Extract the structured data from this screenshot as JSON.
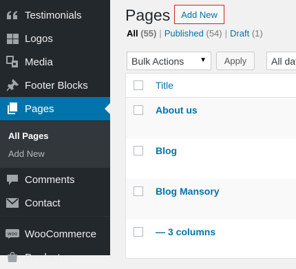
{
  "sidebar": {
    "items": [
      {
        "label": "Testimonials",
        "icon": "quote-icon"
      },
      {
        "label": "Logos",
        "icon": "grid-icon"
      },
      {
        "label": "Media",
        "icon": "media-icon"
      },
      {
        "label": "Footer Blocks",
        "icon": "pin-icon"
      },
      {
        "label": "Pages",
        "icon": "pages-icon"
      },
      {
        "label": "Comments",
        "icon": "comment-icon"
      },
      {
        "label": "Contact",
        "icon": "mail-icon"
      },
      {
        "label": "WooCommerce",
        "icon": "woo-icon"
      },
      {
        "label": "Products",
        "icon": "products-icon"
      }
    ],
    "submenu": [
      {
        "label": "All Pages"
      },
      {
        "label": "Add New"
      }
    ]
  },
  "header": {
    "title": "Pages",
    "add_new_label": "Add New"
  },
  "filters": {
    "all": {
      "label": "All",
      "count": "(55)"
    },
    "published": {
      "label": "Published",
      "count": "(54)"
    },
    "draft": {
      "label": "Draft",
      "count": "(1)"
    },
    "separator": "|"
  },
  "toolbar": {
    "bulk_actions": "Bulk Actions",
    "apply_label": "Apply",
    "date_filter": "All dates"
  },
  "table": {
    "column_title": "Title",
    "rows": [
      {
        "title": "About us"
      },
      {
        "title": "Blog"
      },
      {
        "title": "Blog Mansory"
      },
      {
        "title": "— 3 columns"
      }
    ]
  },
  "colors": {
    "sidebar_bg": "#23282d",
    "submenu_bg": "#32373c",
    "active_bg": "#0073aa",
    "link": "#0073aa",
    "highlight_border": "#c9261f"
  }
}
